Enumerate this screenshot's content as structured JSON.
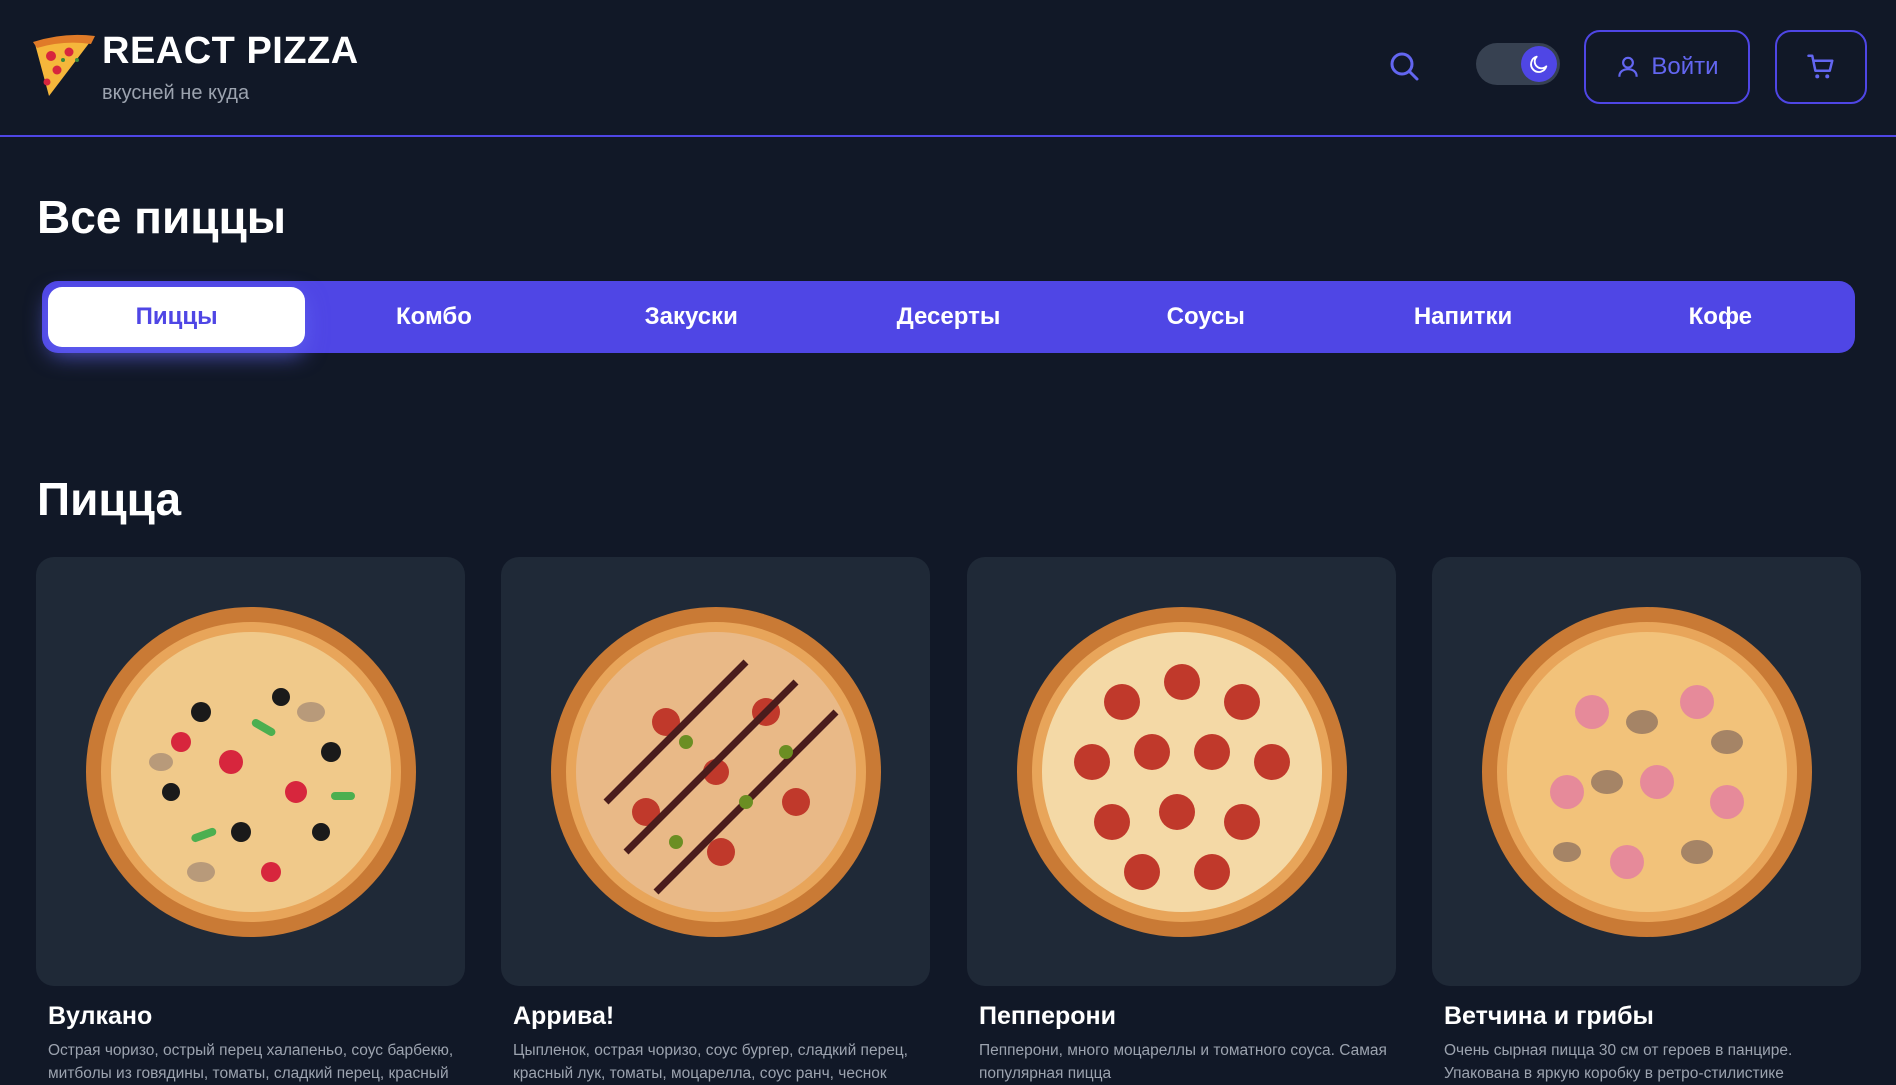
{
  "header": {
    "brand_title": "REACT PIZZA",
    "brand_subtitle": "вкусней не куда",
    "login_label": "Войти"
  },
  "page_title": "Все пиццы",
  "categories": [
    {
      "label": "Пиццы",
      "active": true
    },
    {
      "label": "Комбо"
    },
    {
      "label": "Закуски"
    },
    {
      "label": "Десерты"
    },
    {
      "label": "Соусы"
    },
    {
      "label": "Напитки"
    },
    {
      "label": "Кофе"
    }
  ],
  "section_title": "Пицца",
  "products": [
    {
      "name": "Вулкано",
      "description": "Острая чоризо, острый перец халапеньо, соус барбекю, митболы из говядины, томаты, сладкий перец, красный"
    },
    {
      "name": "Аррива!",
      "description": "Цыпленок, острая чоризо, соус бургер, сладкий перец, красный лук, томаты, моцарелла, соус ранч, чеснок"
    },
    {
      "name": "Пепперони",
      "description": "Пепперони, много моцареллы и томатного соуса. Самая популярная пицца"
    },
    {
      "name": "Ветчина и грибы",
      "description": "Очень сырная пицца 30 см от героев в панцире. Упакована в яркую коробку в ретро-стилистике"
    }
  ],
  "colors": {
    "background": "#111827",
    "accent": "#4f46e5",
    "card": "#1f2937",
    "muted_text": "#9ca3af"
  },
  "icons": [
    "pizza-slice-icon",
    "search-icon",
    "moon-icon",
    "user-icon",
    "cart-icon"
  ]
}
